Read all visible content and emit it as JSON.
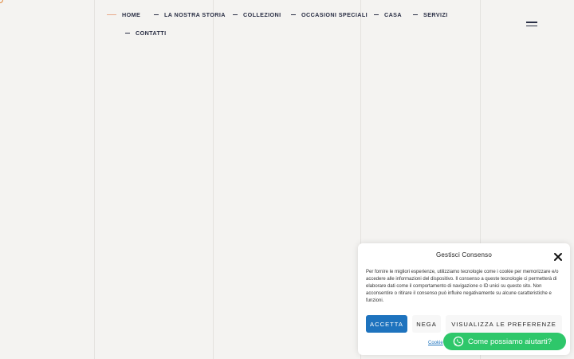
{
  "nav": {
    "items": [
      {
        "label": "HOME",
        "active": true
      },
      {
        "label": "LA NOSTRA STORIA"
      },
      {
        "label": "COLLEZIONI"
      },
      {
        "label": "OCCASIONI SPECIALI"
      },
      {
        "label": "CASA"
      },
      {
        "label": "SERVIZI"
      },
      {
        "label": "CONTATTI"
      }
    ]
  },
  "consent": {
    "title": "Gestisci Consenso",
    "text": "Per fornire le migliori esperienze, utilizziamo tecnologie come i cookie per memorizzare e/o accedere alle informazioni del dispositivo. Il consenso a queste tecnologie ci permetterà di elaborare dati come il comportamento di navigazione o ID unici su questo sito. Non acconsentire o ritirare il consenso può influire negativamente su alcune caratteristiche e funzioni.",
    "accept_label": "ACCETTA",
    "deny_label": "NEGA",
    "preferences_label": "VISUALIZZA LE PREFERENZE",
    "cookie_link": "Cookie"
  },
  "whatsapp": {
    "label": "Come possiamo aiutarti?"
  },
  "colors": {
    "background": "#f4f3f1",
    "nav_text": "#2a2f45",
    "accept_button": "#1e73be",
    "whatsapp_green": "#2ec76a",
    "accent_orange": "#e0873a"
  }
}
